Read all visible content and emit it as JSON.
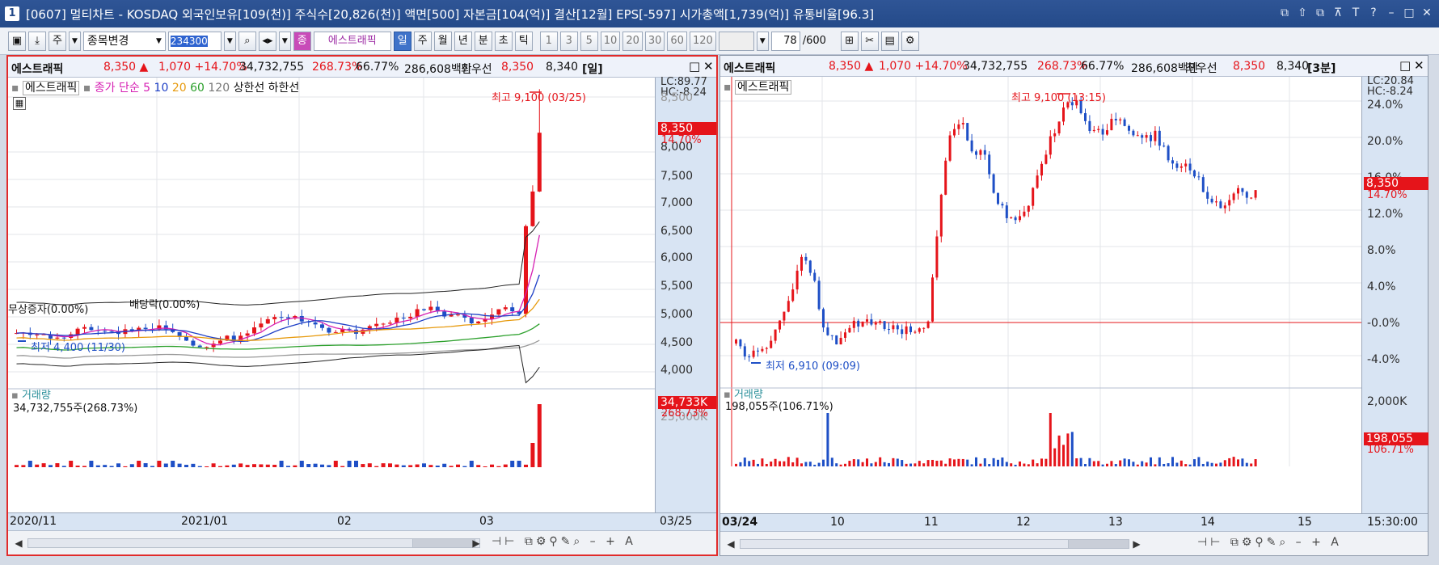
{
  "window": {
    "number": "1",
    "title": "[0607] 멀티차트 - KOSDAQ 외국인보유[109(천)] 주식수[20,826(천)] 액면[500] 자본금[104(억)] 결산[12월] EPS[-597] 시가총액[1,739(억)] 유통비율[96.3]",
    "controls": [
      "⧉",
      "⇧",
      "⧉",
      "⊼",
      "T",
      "?",
      "–",
      "□",
      "✕"
    ]
  },
  "toolbar": {
    "type_label": "주",
    "change_label": "종목변경",
    "code": "234300",
    "stock_badge": "종",
    "stock_name": "에스트래픽",
    "periods": [
      "일",
      "주",
      "월",
      "년",
      "분",
      "초",
      "틱"
    ],
    "selected_period": "일",
    "intervals": [
      "1",
      "3",
      "5",
      "10",
      "20",
      "30",
      "60",
      "120"
    ],
    "count": "78",
    "count_total": "/600"
  },
  "left": {
    "header": {
      "name": "에스트래픽",
      "price": "8,350 ▲",
      "change": "1,070 +14.70%",
      "volume": "34,732,755",
      "vol_rate": "268.73%",
      "ratio": "66.77%",
      "amount": "286,608백만",
      "quote_label": "최우선",
      "ask": "8,350",
      "bid": "8,340",
      "period": "[일]"
    },
    "legend": {
      "name": "에스트래픽",
      "ma_label": "종가 단순 5",
      "ma": [
        "10",
        "20",
        "60",
        "120"
      ],
      "upper": "상한선",
      "lower": "하한선"
    },
    "axis_top": {
      "lc": "LC:89.77",
      "hc": "HC:-8.24"
    },
    "price_label": "8,350",
    "pct_label": "14.70%",
    "y_ticks": [
      "8,500",
      "8,000",
      "7,500",
      "7,000",
      "6,500",
      "6,000",
      "5,500",
      "5,000",
      "4,500",
      "4,000"
    ],
    "high_note": "최고 9,100 (03/25)",
    "low_note": "최저 4,400 (11/30)",
    "event1": "무상증자(0.00%)",
    "event2": "배당락(0.00%)",
    "volume_title": "거래량",
    "volume_value": "34,732,755주(268.73%)",
    "volume_label": "34,733K",
    "volume_pct": "268.73%",
    "vol_tick": "25,000K",
    "x_ticks": [
      "2020/11",
      "2021/01",
      "02",
      "03"
    ],
    "x_end": "03/25"
  },
  "right": {
    "header": {
      "name": "에스트래픽",
      "price": "8,350 ▲",
      "change": "1,070 +14.70%",
      "volume": "34,732,755",
      "vol_rate": "268.73%",
      "ratio": "66.77%",
      "amount": "286,608백만",
      "quote_label": "최우선",
      "ask": "8,350",
      "bid": "8,340",
      "period": "[3분]"
    },
    "legend": {
      "name": "에스트래픽"
    },
    "axis_top": {
      "lc": "LC:20.84",
      "hc": "HC:-8.24"
    },
    "price_label": "8,350",
    "pct_label": "14.70%",
    "y_ticks": [
      "24.0%",
      "20.0%",
      "16.0%",
      "12.0%",
      "8.0%",
      "4.0%",
      "-0.0%",
      "-4.0%"
    ],
    "high_note": "최고 9,100 (13:15)",
    "low_note": "최저 6,910 (09:09)",
    "volume_title": "거래량",
    "volume_value": "198,055주(106.71%)",
    "vol_tick": "2,000K",
    "volume_label": "198,055",
    "volume_pct": "106.71%",
    "x_ticks": [
      "03/24",
      "10",
      "11",
      "12",
      "13",
      "14",
      "15"
    ],
    "x_end": "15:30:00"
  },
  "colors": {
    "up": "#e5141a",
    "down": "#1e4fc6",
    "title": "#244a89",
    "axis_bg": "#d8e4f3"
  }
}
